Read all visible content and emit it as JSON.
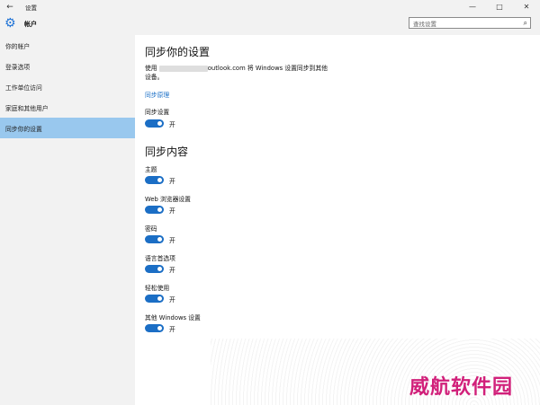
{
  "window": {
    "title": "设置",
    "back_icon": "back-arrow-icon",
    "minimize": "—",
    "maximize": "□",
    "close": "✕"
  },
  "header": {
    "section_title": "帐户",
    "icon": "gear-icon",
    "search_placeholder": "查找设置",
    "search_icon": "search-icon"
  },
  "sidebar": {
    "items": [
      {
        "label": "你的帐户"
      },
      {
        "label": "登录选项"
      },
      {
        "label": "工作单位访问"
      },
      {
        "label": "家庭和其他用户"
      },
      {
        "label": "同步你的设置",
        "active": true
      }
    ]
  },
  "main": {
    "title": "同步你的设置",
    "description_prefix": "使用",
    "description_suffix": "outlook.com 将 Windows 设置同步到其他",
    "description_line2": "设备。",
    "link": "同步原理",
    "sync_label": "同步设置",
    "sync_state": "开",
    "content_title": "同步内容",
    "items": [
      {
        "label": "主题",
        "state": "开"
      },
      {
        "label": "Web 浏览器设置",
        "state": "开"
      },
      {
        "label": "密码",
        "state": "开"
      },
      {
        "label": "语言首选项",
        "state": "开"
      },
      {
        "label": "轻松使用",
        "state": "开"
      },
      {
        "label": "其他 Windows 设置",
        "state": "开"
      }
    ]
  },
  "watermark": "威航软件园",
  "colors": {
    "accent": "#1b6ec5",
    "active_nav": "#99c8ee",
    "sidebar_bg": "#f2f2f2",
    "link": "#1a6fc7",
    "watermark": "#d1207a"
  }
}
